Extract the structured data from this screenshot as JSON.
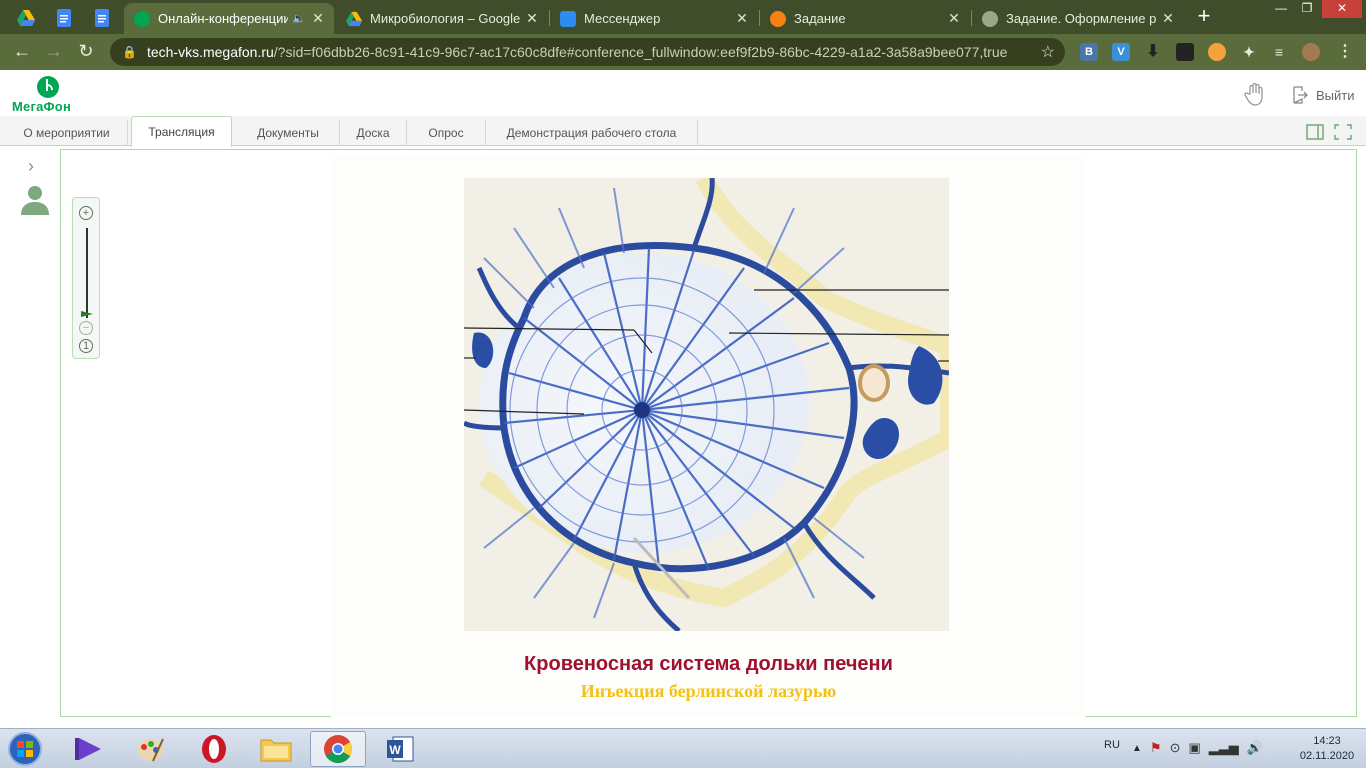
{
  "browser": {
    "tabs": [
      {
        "title": "Онлайн-конференции",
        "favicon": "megafon-favicon",
        "active": true,
        "audio": true
      },
      {
        "title": "Микробиология – Google Д",
        "favicon": "google-drive-favicon"
      },
      {
        "title": "Мессенджер",
        "favicon": "messenger-favicon"
      },
      {
        "title": "Задание",
        "favicon": "moodle-favicon"
      },
      {
        "title": "Задание. Оформление реф",
        "favicon": "globe-favicon"
      }
    ],
    "url_host": "tech-vks.megafon.ru",
    "url_rest": "/?sid=f06dbb26-8c91-41c9-96c7-ac17c60c8dfe#conference_fullwindow:eef9f2b9-86bc-4229-a1a2-3a58a9bee077,true",
    "extensions": [
      "В",
      "V"
    ],
    "colors": {
      "frame": "#3f4d2a",
      "toolbar": "#5a6b3c"
    }
  },
  "app": {
    "logo_text": "МегаФон",
    "exit_label": "Выйти",
    "tabs": [
      "О мероприятии",
      "Трансляция",
      "Документы",
      "Доска",
      "Опрос",
      "Демонстрация рабочего стола"
    ],
    "active_tab": "Трансляция",
    "zoom": {
      "zoom_in": "+",
      "zoom_out": "−",
      "reset": "1"
    },
    "accent": "#00a651"
  },
  "slide": {
    "title": "Кровеносная система дольки печени",
    "subtitle": "Инъекция берлинской лазурью",
    "title_color": "#a01030",
    "subtitle_color": "#f2c215"
  },
  "taskbar": {
    "apps": [
      "media-player-icon",
      "paint-icon",
      "opera-icon",
      "file-explorer-icon",
      "chrome-icon",
      "word-icon"
    ],
    "active_app": "chrome-icon",
    "language": "RU",
    "time": "14:23",
    "date": "02.11.2020"
  }
}
